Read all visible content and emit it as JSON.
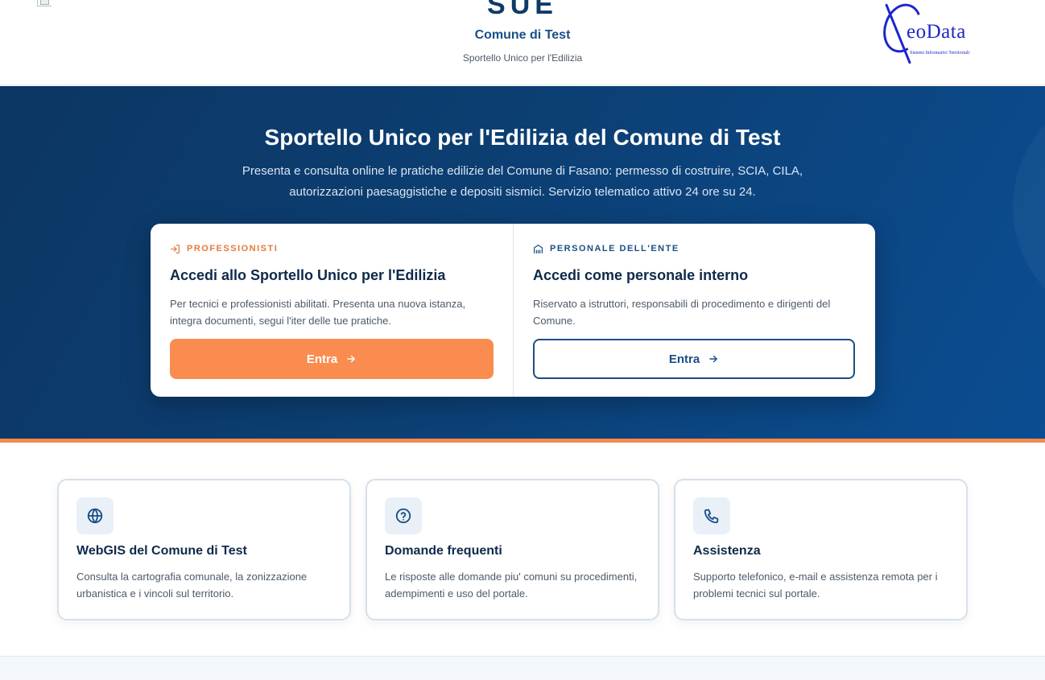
{
  "header": {
    "brand_name": "SUE",
    "municipality": "Comune di Test",
    "tagline": "Sportello Unico per l'Edilizia",
    "logo": {
      "word": "eoData",
      "tagline": "Sistemi Informativi Territoriali"
    }
  },
  "hero": {
    "title": "Sportello Unico per l'Edilizia del Comune di Test",
    "description": "Presenta e consulta online le pratiche edilizie del Comune di Fasano: permesso di costruire, SCIA, CILA, autorizzazioni paesaggistiche e depositi sismici. Servizio telematico attivo 24 ore su 24."
  },
  "access": {
    "professionisti": {
      "eyebrow": "PROFESSIONISTI",
      "title": "Accedi allo Sportello Unico per l'Edilizia",
      "description": "Per tecnici e professionisti abilitati. Presenta una nuova istanza, integra documenti, segui l'iter delle tue pratiche.",
      "button": "Entra"
    },
    "ente": {
      "eyebrow": "PERSONALE DELL'ENTE",
      "title": "Accedi come personale interno",
      "description": "Riservato a istruttori, responsabili di procedimento e dirigenti del Comune.",
      "button": "Entra"
    }
  },
  "services": [
    {
      "icon": "globe-icon",
      "title": "WebGIS del Comune di Test",
      "description": "Consulta la cartografia comunale, la zonizzazione urbanistica e i vincoli sul territorio."
    },
    {
      "icon": "question-icon",
      "title": "Domande frequenti",
      "description": "Le risposte alle domande piu' comuni su procedimenti, adempimenti e uso del portale."
    },
    {
      "icon": "phone-icon",
      "title": "Assistenza",
      "description": "Supporto telefonico, e-mail e assistenza remota per i problemi tecnici sul portale."
    }
  ],
  "colors": {
    "primary": "#0e3a66",
    "accent": "#fb8c4f",
    "hero_start": "#0c3663",
    "hero_end": "#0b4d92"
  }
}
